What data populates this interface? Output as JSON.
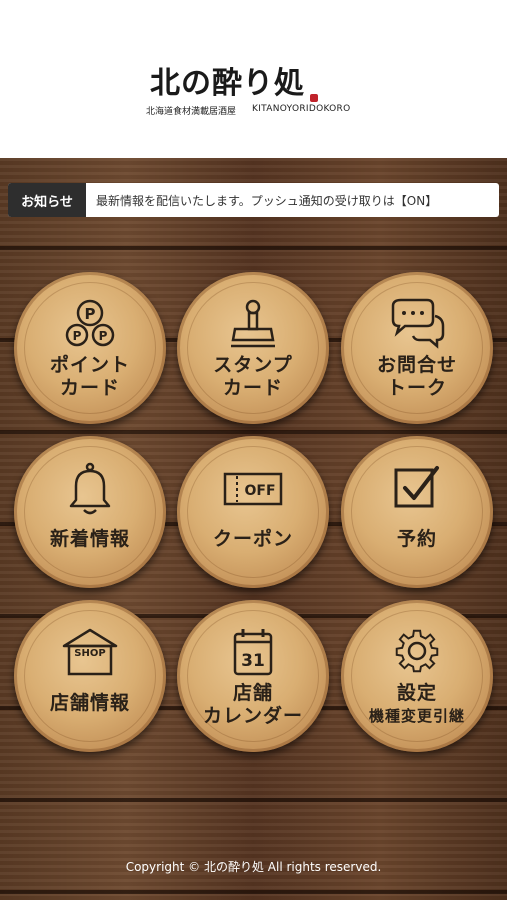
{
  "header": {
    "logo_main": "北の酔り処",
    "logo_sub_jp": "北海道食材満載居酒屋",
    "logo_sub_en": "KITANOYORIDOKORO"
  },
  "notice": {
    "label": "お知らせ",
    "text": "最新情報を配信いたします。プッシュ通知の受け取りは【ON】"
  },
  "menu": {
    "point_card": {
      "line1": "ポイント",
      "line2": "カード",
      "icon": "point-coins-icon"
    },
    "stamp_card": {
      "line1": "スタンプ",
      "line2": "カード",
      "icon": "stamp-icon"
    },
    "inquiry": {
      "line1": "お問合せ",
      "line2": "トーク",
      "icon": "chat-bubbles-icon"
    },
    "news": {
      "label": "新着情報",
      "icon": "bell-icon"
    },
    "coupon": {
      "label": "クーポン",
      "icon": "coupon-off-icon",
      "icon_text": "OFF"
    },
    "reservation": {
      "label": "予約",
      "icon": "checkbox-icon"
    },
    "shop_info": {
      "label": "店舗情報",
      "icon": "shop-icon",
      "icon_text": "SHOP"
    },
    "calendar": {
      "line1": "店舗",
      "line2": "カレンダー",
      "icon": "calendar-icon",
      "icon_text": "31"
    },
    "settings": {
      "line1": "設定",
      "line2": "機種変更引継",
      "icon": "gear-icon"
    }
  },
  "footer": {
    "copyright": "Copyright © 北の酔り処 All rights reserved."
  }
}
